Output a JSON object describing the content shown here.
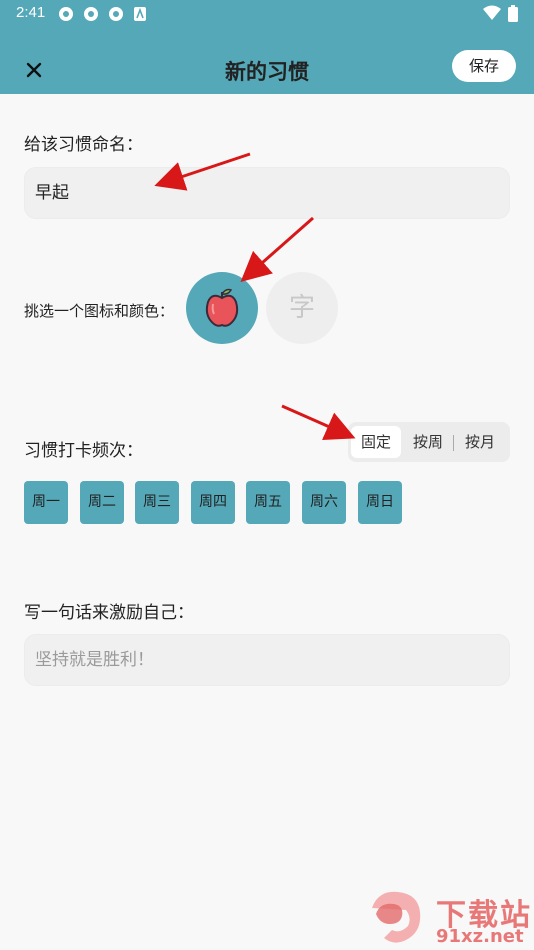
{
  "status_bar": {
    "time": "2:41"
  },
  "header": {
    "title": "新的习惯",
    "save_label": "保存"
  },
  "name_section": {
    "label": "给该习惯命名：",
    "value": "早起"
  },
  "icon_section": {
    "label": "挑选一个图标和颜色：",
    "selected_icon": "apple-icon",
    "alt_icon_char": "字"
  },
  "frequency_section": {
    "label": "习惯打卡频次：",
    "modes": [
      "固定",
      "按周",
      "按月"
    ],
    "selected_mode": "固定",
    "days": [
      "周一",
      "周二",
      "周三",
      "周四",
      "周五",
      "周六",
      "周日"
    ]
  },
  "motto_section": {
    "label": "写一句话来激励自己：",
    "placeholder": "坚持就是胜利！"
  },
  "watermark": {
    "brand": "下载站",
    "url": "91xz.net"
  },
  "colors": {
    "accent": "#54a8b8",
    "arrow": "#d81818",
    "apple": "#e8545a"
  }
}
